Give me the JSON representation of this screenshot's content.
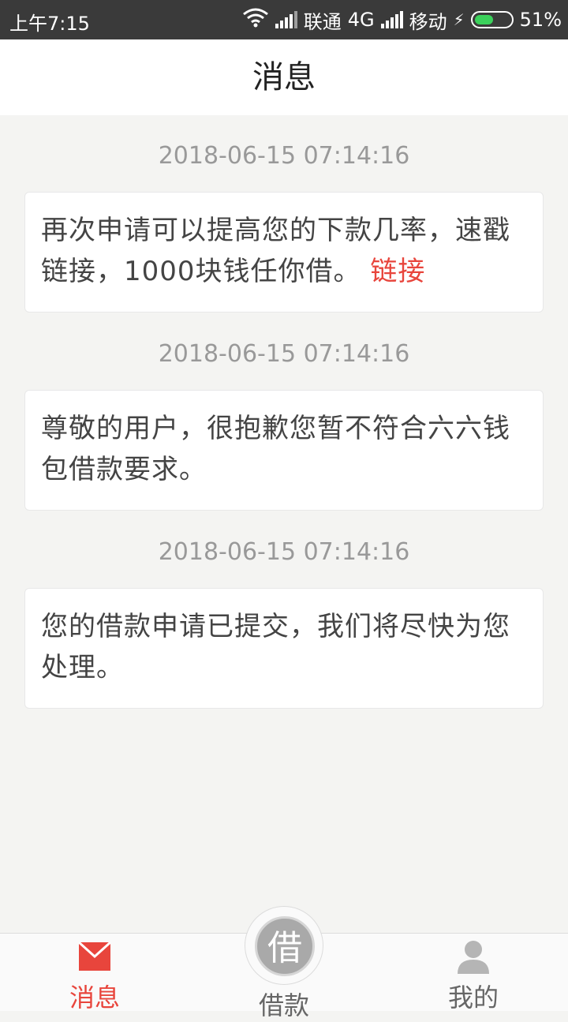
{
  "status_bar": {
    "time": "上午7:15",
    "carrier1": "联通",
    "network1": "4G",
    "carrier2": "移动",
    "battery": "51%",
    "battery_level": 0.51,
    "battery_color": "#3bd15b"
  },
  "header": {
    "title": "消息"
  },
  "messages": [
    {
      "time": "2018-06-15 07:14:16",
      "text": "再次申请可以提高您的下款几率，速戳 链接，1000块钱任你借。",
      "link": "链接"
    },
    {
      "time": "2018-06-15 07:14:16",
      "text": "尊敬的用户，很抱歉您暂不符合六六钱包借款要求。"
    },
    {
      "time": "2018-06-15 07:14:16",
      "text": "您的借款申请已提交，我们将尽快为您处理。"
    }
  ],
  "tabbar": {
    "messages_label": "消息",
    "borrow_label": "借款",
    "borrow_icon_char": "借",
    "mine_label": "我的",
    "active_color": "#e8453c"
  }
}
